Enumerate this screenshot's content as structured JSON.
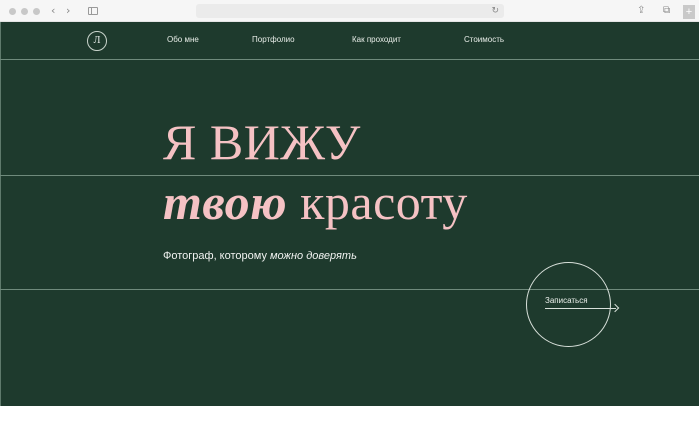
{
  "browser": {
    "back_icon": "‹",
    "forward_icon": "›",
    "reload_icon": "↻",
    "share_icon": "⇪",
    "tabs_icon": "⧉",
    "new_tab_icon": "+"
  },
  "site": {
    "logo_letter": "Л",
    "nav": [
      {
        "label": "Обо мне"
      },
      {
        "label": "Портфолио"
      },
      {
        "label": "Как проходит"
      },
      {
        "label": "Стоимость"
      }
    ]
  },
  "hero": {
    "line1": "Я ВИЖУ",
    "line2_accent": "твою",
    "line2_rest": " красоту",
    "subtitle_plain": "Фотограф, которому ",
    "subtitle_emphasis": "можно доверять",
    "cta_label": "Записаться"
  },
  "colors": {
    "background": "#1e3a2d",
    "headline": "#f5c2c4",
    "text": "#f0f2f0"
  }
}
